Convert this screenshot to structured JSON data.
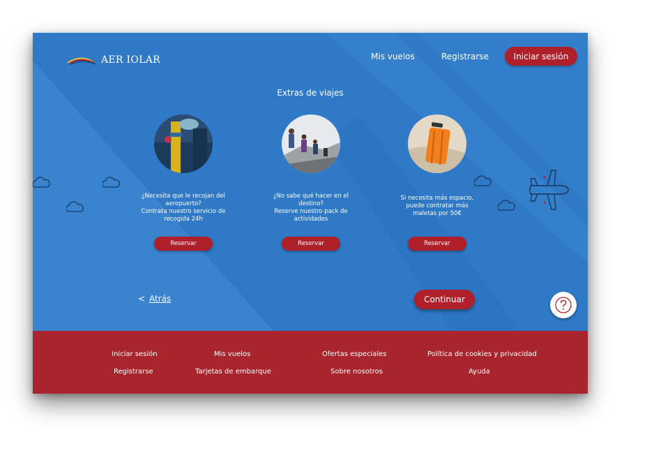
{
  "header": {
    "brand": "AER IOLAR",
    "nav": {
      "my_flights": "Mis vuelos",
      "register": "Registrarse",
      "login": "Iniciar sesión"
    }
  },
  "main": {
    "title": "Extras de viajes",
    "extras": [
      {
        "text_lines": [
          "¿Necesita que le recojan del",
          "aeropuerto?",
          "Contrata nuestro servicio de",
          "recogida 24h"
        ],
        "button": "Reservar"
      },
      {
        "text_lines": [
          "¿No sabe qué hacer en el",
          "destino?",
          "Reserve nuestro pack de",
          "actividades"
        ],
        "button": "Reservar"
      },
      {
        "text_lines": [
          "Si necesita más espacio,",
          "puede contratar más",
          "maletas por 50€"
        ],
        "button": "Reservar"
      }
    ],
    "back": {
      "arrow": "<",
      "label": "Atrás"
    },
    "continue": "Continuar",
    "help_icon": "question-icon"
  },
  "footer": {
    "links": [
      "Iniciar sesión",
      "Mis vuelos",
      "Ofertas especiales",
      "Política de cookies y privacidad",
      "Registrarse",
      "Tarjetas de embarque",
      "Sobre nosotros",
      "Ayuda"
    ]
  },
  "colors": {
    "hero_blue": "#2f79c6",
    "brand_red": "#b0202b",
    "footer_red": "#a8252e"
  }
}
